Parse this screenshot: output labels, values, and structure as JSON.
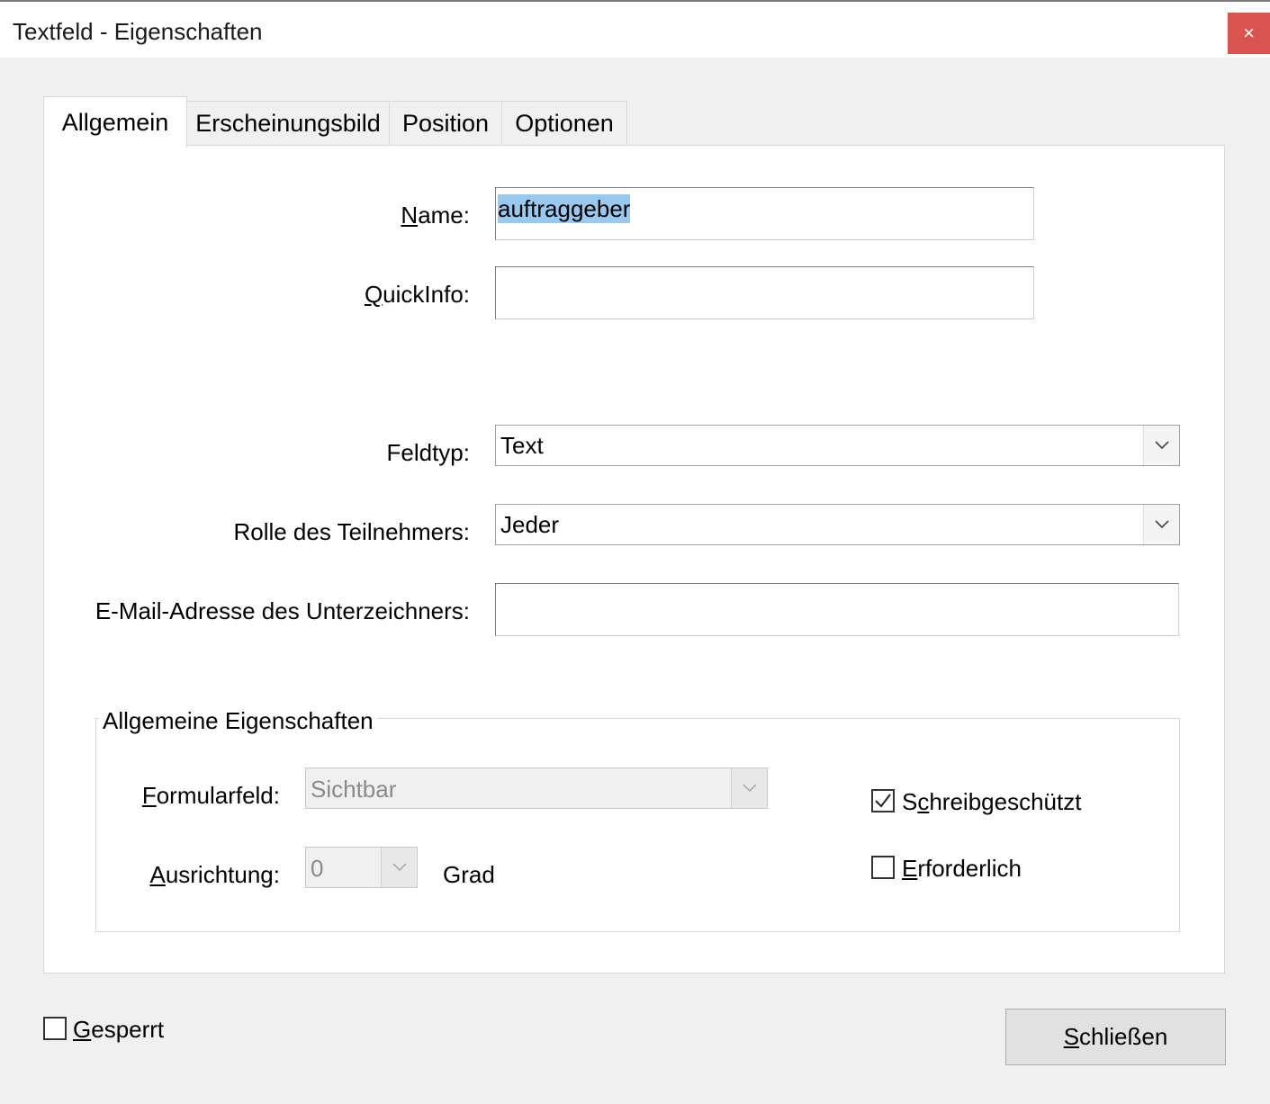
{
  "window": {
    "title": "Textfeld - Eigenschaften",
    "close_glyph": "×"
  },
  "tabs": [
    {
      "label": "Allgemein",
      "active": true
    },
    {
      "label": "Erscheinungsbild",
      "active": false
    },
    {
      "label": "Position",
      "active": false
    },
    {
      "label": "Optionen",
      "active": false
    }
  ],
  "form": {
    "name_label": "Name:",
    "name_value": "auftraggeber",
    "quickinfo_label": "QuickInfo:",
    "quickinfo_value": "",
    "feldtyp_label": "Feldtyp:",
    "feldtyp_value": "Text",
    "rolle_label": "Rolle des Teilnehmers:",
    "rolle_value": "Jeder",
    "email_label": "E-Mail-Adresse des Unterzeichners:",
    "email_value": ""
  },
  "general_properties": {
    "legend": "Allgemeine Eigenschaften",
    "formularfeld_label": "Formularfeld:",
    "formularfeld_value": "Sichtbar",
    "ausrichtung_label": "Ausrichtung:",
    "ausrichtung_value": "0",
    "ausrichtung_unit": "Grad",
    "schreibgeschuetzt_label": "Schreibgeschützt",
    "schreibgeschuetzt_checked": true,
    "erforderlich_label": "Erforderlich",
    "erforderlich_checked": false
  },
  "footer": {
    "gesperrt_label": "Gesperrt",
    "gesperrt_checked": false,
    "close_button_label": "Schließen"
  },
  "icons": {
    "dropdown": "chevron-down-icon",
    "check": "checkmark-icon",
    "close": "close-icon"
  },
  "colors": {
    "selection": "#99c9ef",
    "close_button": "#d9534f",
    "dialog_background": "#f0f0f0"
  }
}
